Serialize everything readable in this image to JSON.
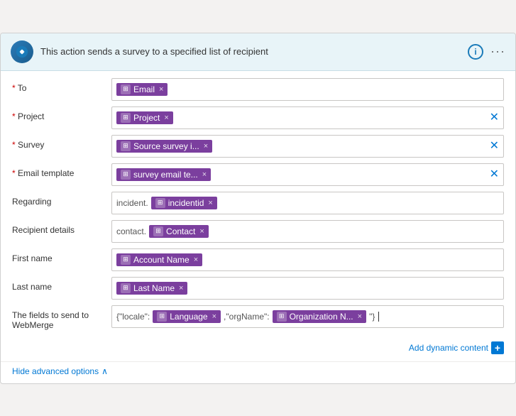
{
  "header": {
    "title": "This action sends a survey to a specified list of recipient",
    "info_label": "i",
    "more_label": "···"
  },
  "fields": [
    {
      "id": "to",
      "label": "To",
      "required": true,
      "tokens": [
        {
          "label": "Email",
          "has_icon": true
        }
      ],
      "has_field_clear": false,
      "prefix": "",
      "extra_tokens": []
    },
    {
      "id": "project",
      "label": "Project",
      "required": true,
      "tokens": [
        {
          "label": "Project",
          "has_icon": true
        }
      ],
      "has_field_clear": true,
      "prefix": "",
      "extra_tokens": []
    },
    {
      "id": "survey",
      "label": "Survey",
      "required": true,
      "tokens": [
        {
          "label": "Source survey i...",
          "has_icon": true
        }
      ],
      "has_field_clear": true,
      "prefix": "",
      "extra_tokens": []
    },
    {
      "id": "email-template",
      "label": "Email template",
      "required": true,
      "tokens": [
        {
          "label": "survey email te...",
          "has_icon": true
        }
      ],
      "has_field_clear": true,
      "prefix": "",
      "extra_tokens": []
    },
    {
      "id": "regarding",
      "label": "Regarding",
      "required": false,
      "prefix": "incident.",
      "tokens": [
        {
          "label": "incidentid",
          "has_icon": true
        }
      ],
      "has_field_clear": false,
      "extra_tokens": []
    },
    {
      "id": "recipient-details",
      "label": "Recipient details",
      "required": false,
      "prefix": "contact.",
      "tokens": [
        {
          "label": "Contact",
          "has_icon": true
        }
      ],
      "has_field_clear": false,
      "extra_tokens": []
    },
    {
      "id": "first-name",
      "label": "First name",
      "required": false,
      "prefix": "",
      "tokens": [
        {
          "label": "Account Name",
          "has_icon": true
        }
      ],
      "has_field_clear": false,
      "extra_tokens": []
    },
    {
      "id": "last-name",
      "label": "Last name",
      "required": false,
      "prefix": "",
      "tokens": [
        {
          "label": "Last Name",
          "has_icon": true
        }
      ],
      "has_field_clear": false,
      "extra_tokens": []
    },
    {
      "id": "webmerge",
      "label": "The fields to send to WebMerge",
      "required": false,
      "prefix": "{\"locale\":",
      "tokens": [
        {
          "label": "Language",
          "has_icon": true
        }
      ],
      "suffix": ",\"orgName\":",
      "extra_tokens": [
        {
          "label": "Organization N...",
          "has_icon": true
        }
      ],
      "trailing": " \"}",
      "has_field_clear": false
    }
  ],
  "footer": {
    "add_dynamic_label": "Add dynamic content",
    "add_dynamic_icon": "+"
  },
  "advanced": {
    "hide_label": "Hide advanced options",
    "chevron": "∧"
  }
}
